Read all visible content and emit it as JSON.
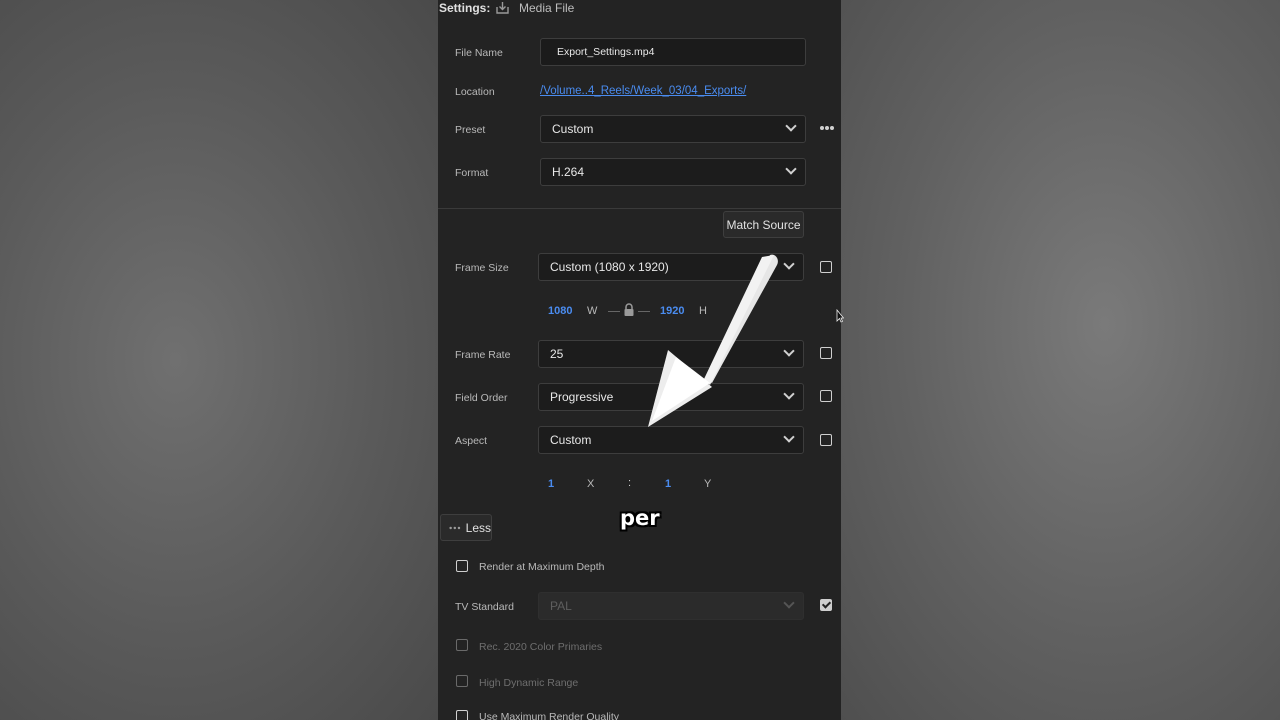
{
  "header": {
    "settings_label": "Settings:",
    "media_file_label": "Media File"
  },
  "file_name": {
    "label": "File Name",
    "value": "Export_Settings.mp4"
  },
  "location": {
    "label": "Location",
    "value": "/Volume..4_Reels/Week_03/04_Exports/"
  },
  "preset": {
    "label": "Preset",
    "value": "Custom"
  },
  "format": {
    "label": "Format",
    "value": "H.264"
  },
  "match_source_label": "Match Source",
  "frame_size": {
    "label": "Frame Size",
    "value": "Custom (1080 x 1920)",
    "width": "1080",
    "width_label": "W",
    "height": "1920",
    "height_label": "H"
  },
  "frame_rate": {
    "label": "Frame Rate",
    "value": "25"
  },
  "field_order": {
    "label": "Field Order",
    "value": "Progressive"
  },
  "aspect": {
    "label": "Aspect",
    "value": "Custom",
    "x_value": "1",
    "x_label": "X",
    "separator": ":",
    "y_value": "1",
    "y_label": "Y"
  },
  "less_label": "Less",
  "render_max_depth_label": "Render at Maximum Depth",
  "tv_standard": {
    "label": "TV Standard",
    "value": "PAL",
    "checked": true
  },
  "rec2020_label": "Rec. 2020 Color Primaries",
  "hdr_label": "High Dynamic Range",
  "max_render_quality_label": "Use Maximum Render Quality",
  "caption_text": "per",
  "colors": {
    "accent": "#4a8cf0",
    "panel_bg": "#232323"
  }
}
